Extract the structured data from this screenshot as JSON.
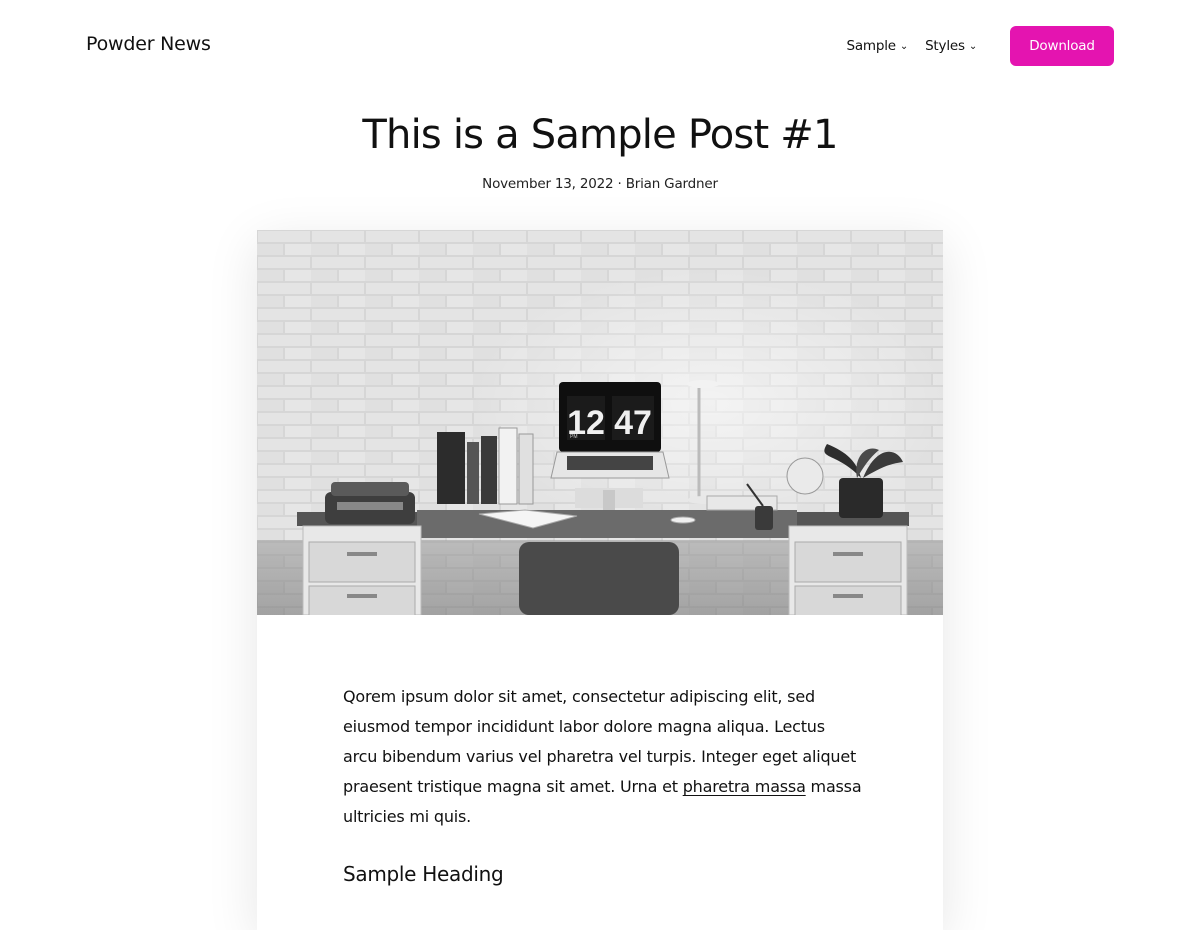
{
  "site": {
    "title": "Powder News"
  },
  "nav": {
    "items": [
      {
        "label": "Sample"
      },
      {
        "label": "Styles"
      }
    ],
    "download_label": "Download"
  },
  "post": {
    "title": "This is a Sample Post #1",
    "date": "November 13, 2022",
    "separator": "·",
    "author": "Brian Gardner",
    "image": {
      "clock_hours": "12",
      "clock_minutes": "47",
      "clock_period": "PM"
    },
    "body": {
      "para_before_link": "Qorem ipsum dolor sit amet, consectetur adipiscing elit, sed eiusmod tempor incididunt labor dolore magna aliqua. Lectus arcu bibendum varius vel pharetra vel turpis. Integer eget aliquet praesent tristique magna sit amet. Urna et ",
      "link_text": "pharetra massa",
      "para_after_link": " massa ultricies mi quis.",
      "heading": "Sample Heading"
    }
  },
  "colors": {
    "accent": "#e414b0",
    "text": "#111111",
    "background": "#ffffff"
  },
  "icons": {
    "nav_chevron": "chevron-down-icon"
  }
}
